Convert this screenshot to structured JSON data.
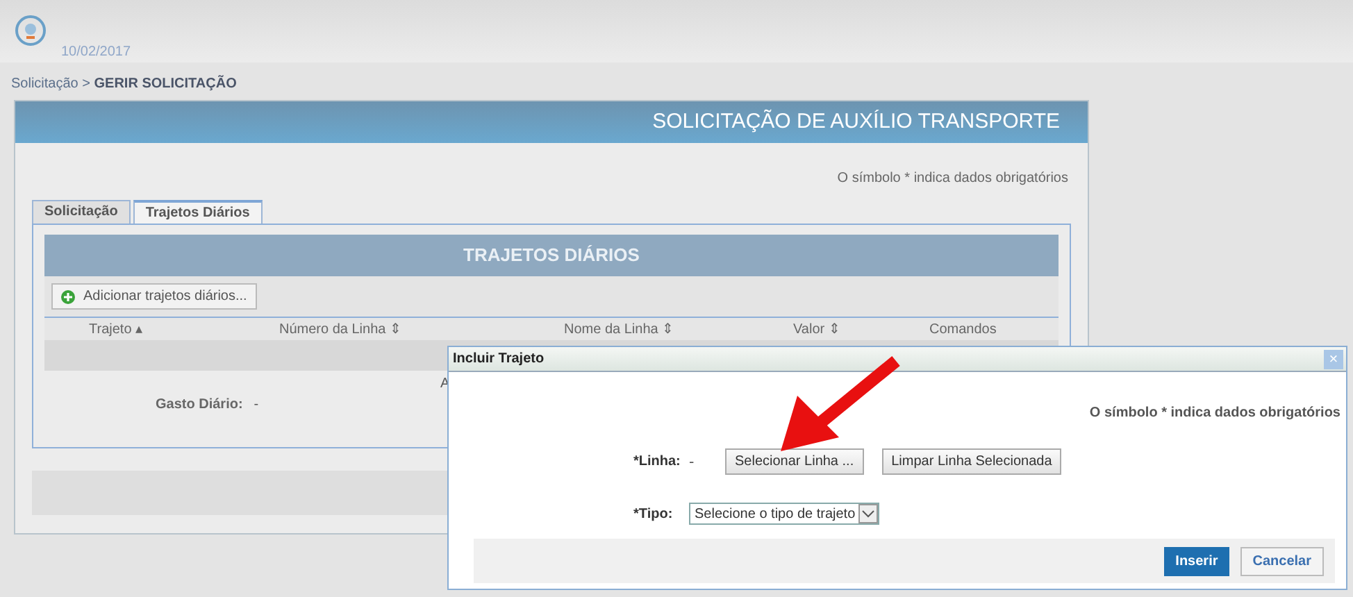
{
  "header": {
    "date": "10/02/2017"
  },
  "breadcrumb": {
    "parent": "Solicitação >",
    "current": "GERIR SOLICITAÇÃO"
  },
  "panel": {
    "title": "SOLICITAÇÃO DE AUXÍLIO TRANSPORTE",
    "required_note": "O símbolo * indica dados obrigatórios"
  },
  "tabs": [
    {
      "label": "Solicitação",
      "selected": false
    },
    {
      "label": "Trajetos Diários",
      "selected": true
    }
  ],
  "section": {
    "title": "TRAJETOS DIÁRIOS",
    "add_button": "Adicionar trajetos diários...",
    "columns": [
      "Trajeto ▴",
      "Número da Linha ⇕",
      "Nome da Linha ⇕",
      "Valor ⇕",
      "Comandos"
    ],
    "empty_message": "A",
    "total_label": "Gasto Diário:",
    "total_value": "-"
  },
  "dialog": {
    "title": "Incluir Trajeto",
    "close": "×",
    "required_note": "O símbolo * indica dados obrigatórios",
    "line_label": "*Linha:",
    "line_value": "-",
    "select_button": "Selecionar Linha ...",
    "clear_button": "Limpar Linha Selecionada",
    "type_label": "*Tipo:",
    "type_placeholder": "Selecione o tipo de trajeto",
    "insert_button": "Inserir",
    "cancel_button": "Cancelar"
  }
}
